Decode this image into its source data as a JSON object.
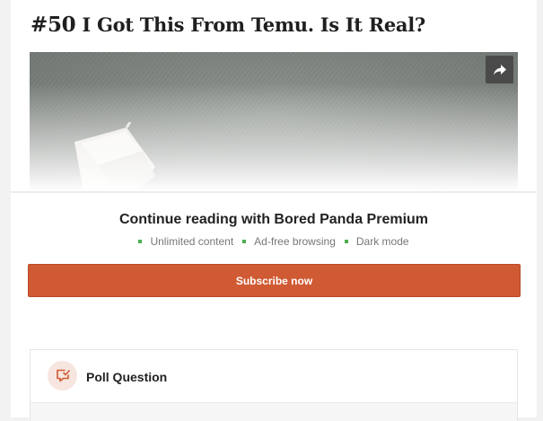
{
  "article": {
    "number": "#50",
    "title": "I Got This From Temu. Is It Real?"
  },
  "image": {
    "share_icon": "share-arrow-icon"
  },
  "paywall": {
    "heading": "Continue reading with Bored Panda Premium",
    "features": [
      "Unlimited content",
      "Ad-free browsing",
      "Dark mode"
    ],
    "subscribe_label": "Subscribe now"
  },
  "poll": {
    "title": "Poll Question",
    "icon": "poll-chat-icon"
  },
  "colors": {
    "accent": "#d05a33",
    "feature_dot": "#4caf50",
    "text": "#222222"
  }
}
